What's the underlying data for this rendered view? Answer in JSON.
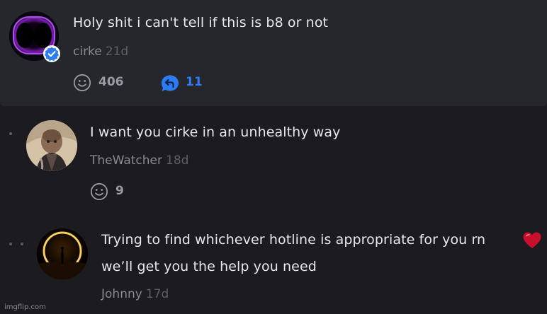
{
  "comments": [
    {
      "text": "Holy shit i can't tell if this is b8 or not",
      "username": "cirke",
      "age": "21d",
      "likes": "406",
      "replies": "11",
      "verified": true
    },
    {
      "text": "I want you cirke in an unhealthy way",
      "username": "TheWatcher",
      "age": "18d",
      "likes": "9"
    },
    {
      "lines": [
        "Trying to find whichever hotline is appropriate for you rn",
        "we’ll get you the help you need"
      ],
      "username": "Johnny",
      "age": "17d",
      "emoji": "red-heart-icon"
    }
  ],
  "watermark": "imgflip.com",
  "colors": {
    "accent_blue": "#2d7cf6",
    "panel": "#26272c",
    "background": "#1b1b20",
    "heart": "#c8102e"
  }
}
